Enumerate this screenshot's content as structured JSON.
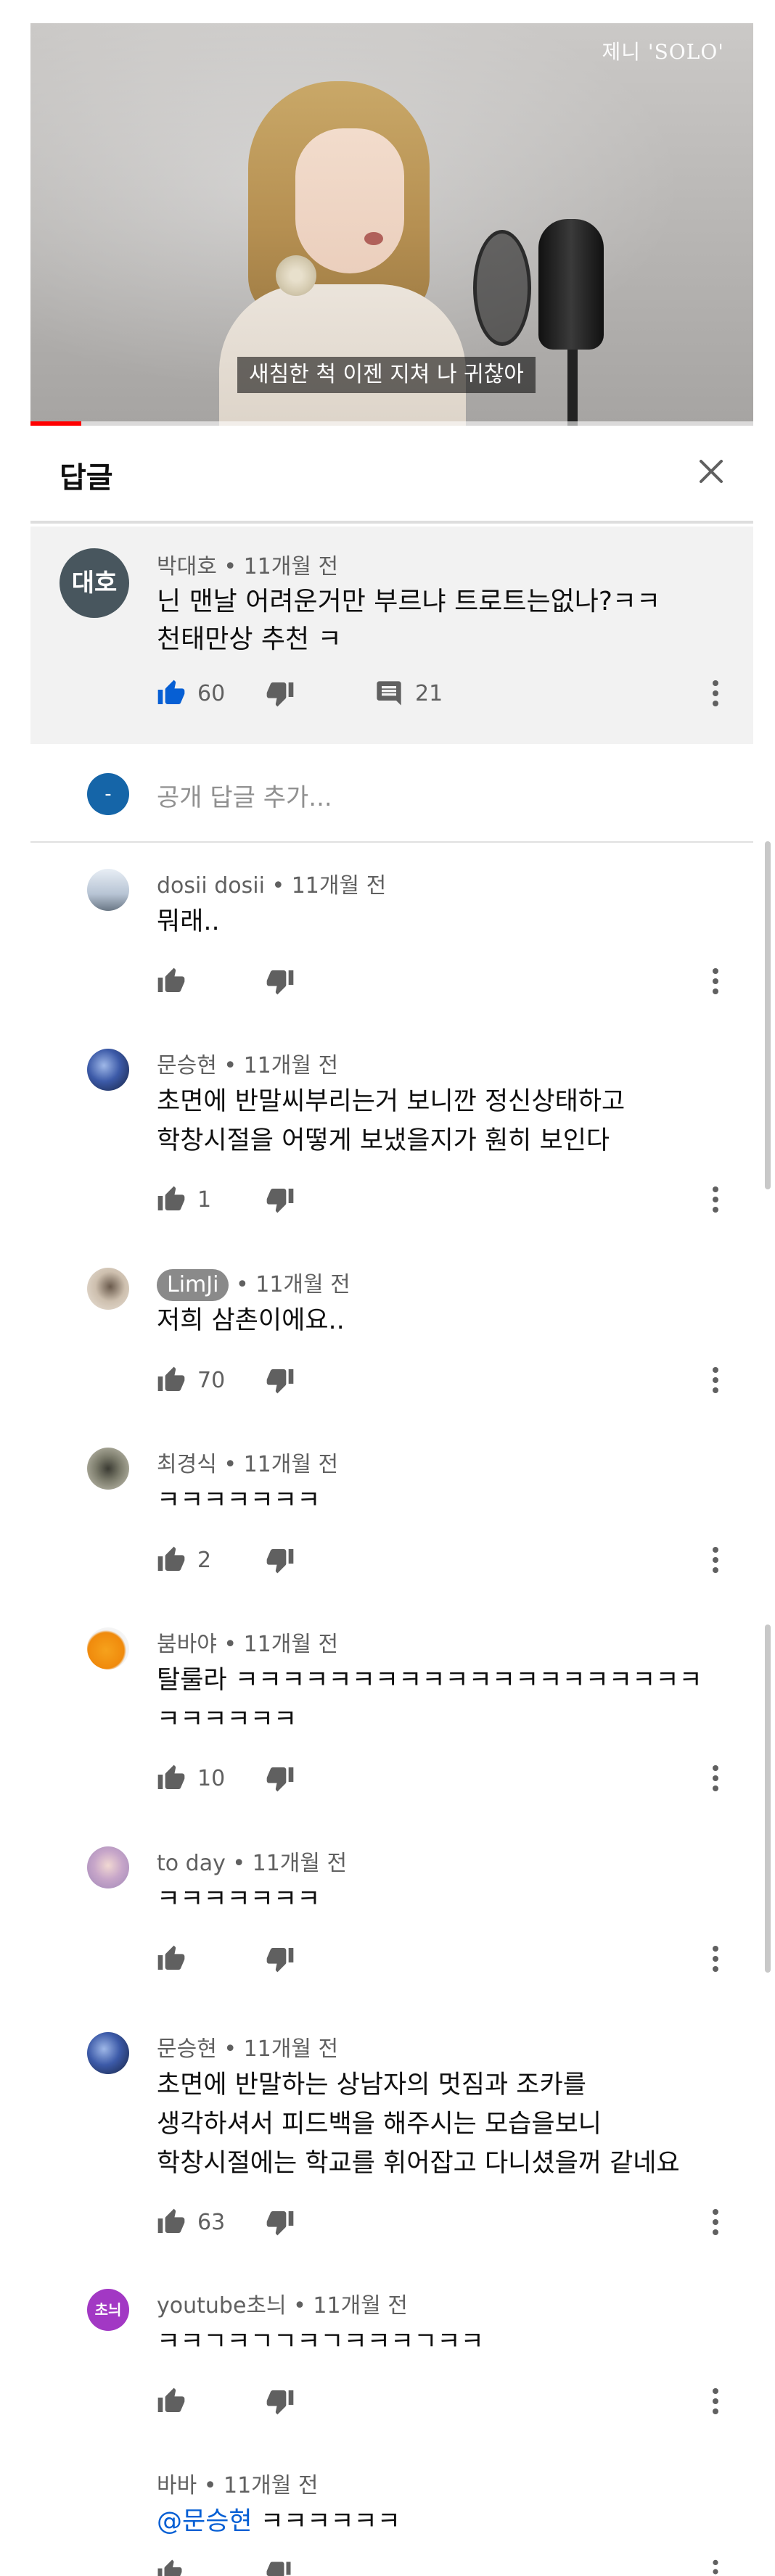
{
  "video": {
    "watermark": "제니 'SOLO'",
    "subtitle": "새침한 척 이젠 지쳐 나 귀찮아",
    "progress": 0.07
  },
  "header": {
    "title": "답글"
  },
  "parent_comment": {
    "avatar_text": "대호",
    "avatar_color": "#48565e",
    "author": "박대호",
    "time": "11개월 전",
    "text_line1": "닌 맨날 어려운거만 부르냐 트로트는없나?ㅋㅋ",
    "text_line2": "천태만상 추천 ㅋ",
    "likes": "60",
    "replies": "21"
  },
  "add_reply": {
    "avatar_text": "-",
    "placeholder": "공개 답글 추가..."
  },
  "replies": [
    {
      "author": "dosii dosii",
      "time": "11개월 전",
      "lines": [
        "뭐래.."
      ],
      "likes": ""
    },
    {
      "author": "문승현",
      "time": "11개월 전",
      "lines": [
        "초면에 반말씨부리는거 보니깐 정신상태하고",
        "학창시절을 어떻게 보냈을지가 훤히 보인다"
      ],
      "likes": "1"
    },
    {
      "author": "LimJi",
      "time": "11개월 전",
      "lines": [
        "저희 삼촌이에요.."
      ],
      "likes": "70"
    },
    {
      "author": "최경식",
      "time": "11개월 전",
      "lines": [
        "ㅋㅋㅋㅋㅋㅋㅋ"
      ],
      "likes": "2"
    },
    {
      "author": "붐바야",
      "time": "11개월 전",
      "lines": [
        "탈룰라 ㅋㅋㅋㅋㅋㅋㅋㅋㅋㅋㅋㅋㅋㅋㅋㅋㅋㅋㅋㅋ",
        "ㅋㅋㅋㅋㅋㅋ"
      ],
      "likes": "10"
    },
    {
      "author": "to day",
      "time": "11개월 전",
      "lines": [
        "ㅋㅋㅋㅋㅋㅋㅋ"
      ],
      "likes": ""
    },
    {
      "author": "문승현",
      "time": "11개월 전",
      "lines": [
        "초면에 반말하는 상남자의 멋짐과 조카를",
        "생각하셔서 피드백을 해주시는 모습을보니",
        "학창시절에는 학교를 휘어잡고 다니셨을꺼 같네요"
      ],
      "likes": "63"
    },
    {
      "author": "youtube초늬",
      "time": "11개월 전",
      "lines": [
        "ㅋㅋㄱㅋㄱㄱㅋㄱㅋㅋㅋㄱㅋㅋ"
      ],
      "likes": "",
      "avatar_text": "초늬"
    },
    {
      "author": "바바",
      "time": "11개월 전",
      "mention": "@문승현",
      "lines": [
        " ㅋㅋㅋㅋㅋㅋ"
      ],
      "likes": ""
    }
  ],
  "colors": {
    "like_active": "#065fd4",
    "icon": "#606060",
    "background_parent": "#f2f2f2",
    "progress": "#ff0000"
  },
  "icons": [
    "close-icon",
    "thumb-up-icon",
    "thumb-down-icon",
    "reply-comment-icon",
    "more-vert-icon"
  ]
}
